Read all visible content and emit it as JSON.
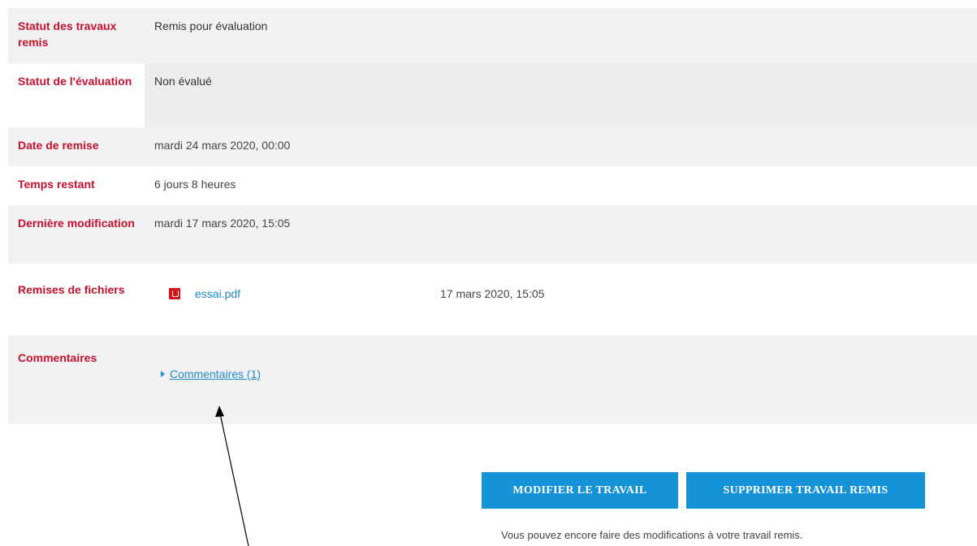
{
  "submission_status": {
    "rows": [
      {
        "label": "Statut des travaux remis",
        "value": "Remis pour évaluation"
      },
      {
        "label": "Statut de l'évaluation",
        "value": "Non évalué"
      },
      {
        "label": "Date de remise",
        "value": "mardi 24 mars 2020, 00:00"
      },
      {
        "label": "Temps restant",
        "value": "6 jours 8 heures"
      },
      {
        "label": "Dernière modification",
        "value": "mardi 17 mars 2020, 15:05"
      },
      {
        "label": "Remises de fichiers",
        "file_name": "essai.pdf",
        "file_date": "17 mars 2020, 15:05",
        "file_icon": "pdf-icon"
      },
      {
        "label": "Commentaires",
        "comments_link": "Commentaires (1)"
      }
    ]
  },
  "actions": {
    "modify_label": "MODIFIER LE TRAVAIL",
    "delete_label": "SUPPRIMER TRAVAIL REMIS",
    "hint": "Vous pouvez encore faire des modifications à votre travail remis."
  },
  "colors": {
    "label_red": "#c8102e",
    "link_blue": "#1f8ace",
    "button_blue": "#1593d8"
  }
}
